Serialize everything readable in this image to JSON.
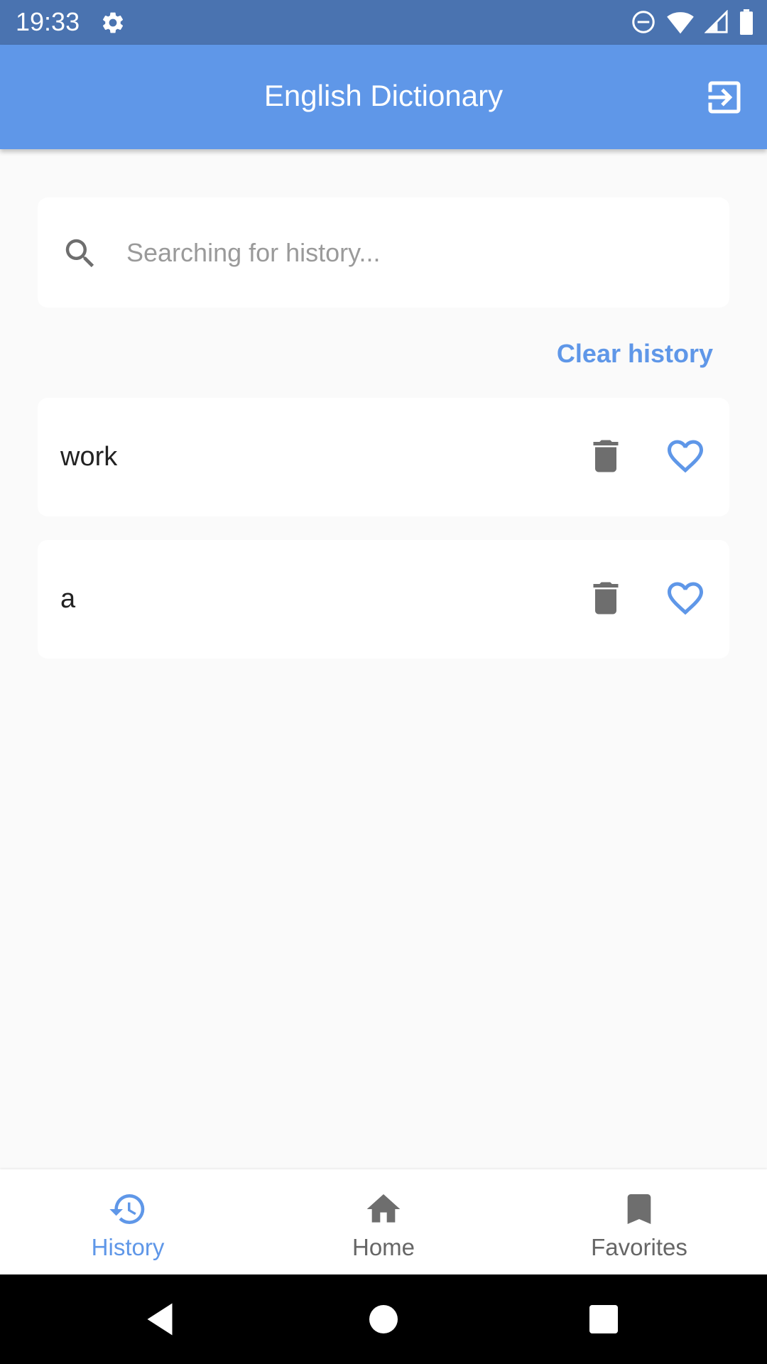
{
  "status_bar": {
    "time": "19:33",
    "icons": [
      "settings-icon",
      "do-not-disturb-icon",
      "wifi-icon",
      "signal-icon",
      "battery-icon"
    ]
  },
  "app_bar": {
    "title": "English Dictionary",
    "action_icon": "exit-to-app-icon"
  },
  "search": {
    "placeholder": "Searching for history...",
    "value": ""
  },
  "clear_history_label": "Clear history",
  "history": [
    {
      "word": "work"
    },
    {
      "word": "a"
    }
  ],
  "bottom_nav": {
    "active": "History",
    "items": [
      {
        "label": "History",
        "icon": "history-icon"
      },
      {
        "label": "Home",
        "icon": "home-icon"
      },
      {
        "label": "Favorites",
        "icon": "bookmark-icon"
      }
    ]
  },
  "colors": {
    "status_bar": "#4a73b0",
    "app_bar": "#5f97e8",
    "accent": "#5f97e8",
    "icon_grey": "#6e6e6e",
    "background": "#fafafa"
  }
}
